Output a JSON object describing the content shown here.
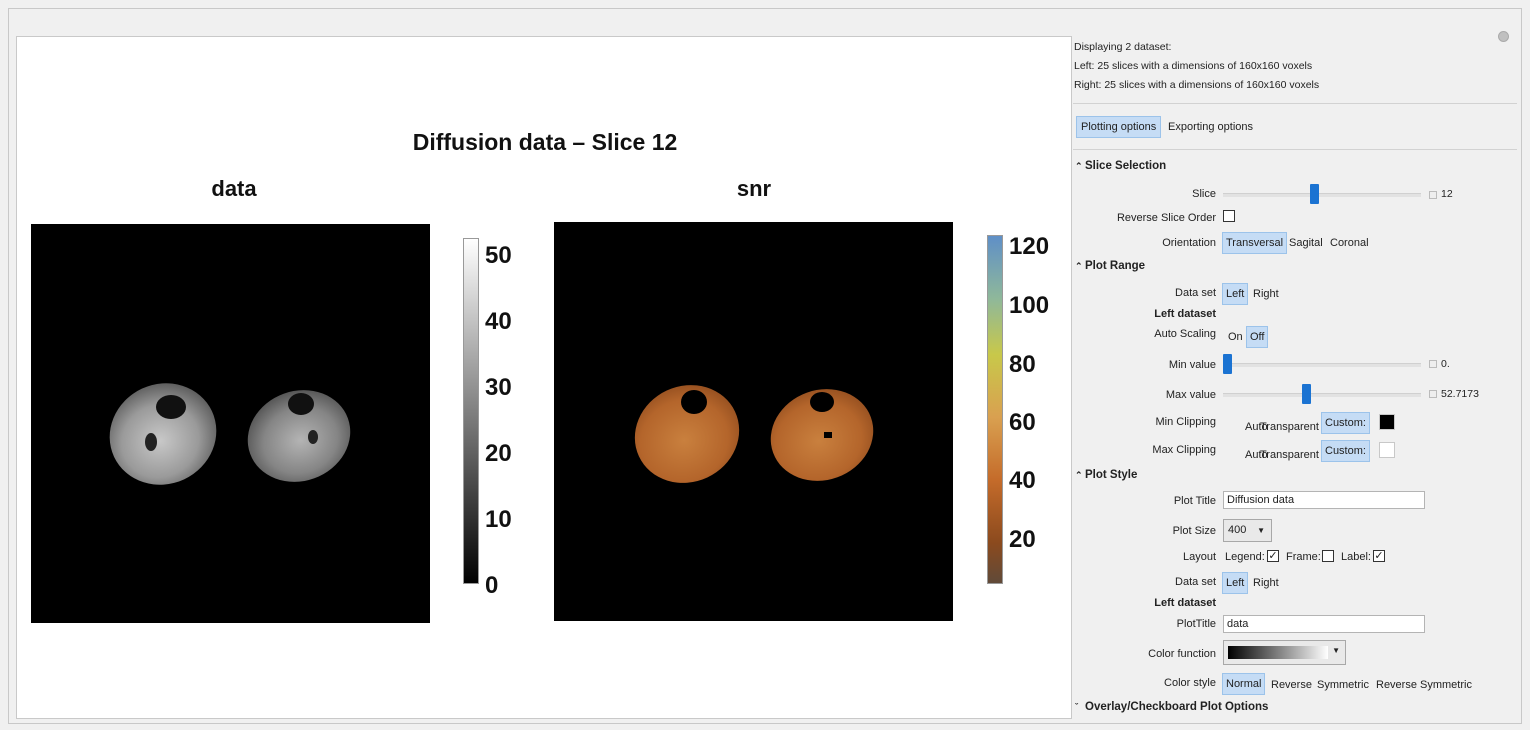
{
  "plot": {
    "title": "Diffusion data – Slice 12",
    "left_title": "data",
    "right_title": "snr",
    "left_colorbar_ticks": [
      "50",
      "40",
      "30",
      "20",
      "10",
      "0"
    ],
    "right_colorbar_ticks": [
      "120",
      "100",
      "80",
      "60",
      "40",
      "20"
    ]
  },
  "info": {
    "line1": "Displaying 2 dataset:",
    "line2": "Left: 25 slices with a dimensions of 160x160 voxels",
    "line3": "Right: 25 slices with a dimensions of 160x160 voxels"
  },
  "tabs": {
    "plotting": "Plotting options",
    "exporting": "Exporting options"
  },
  "slice_selection": {
    "header": "Slice Selection",
    "slice_label": "Slice",
    "slice_value": "12",
    "slice_fraction": 0.46,
    "reverse_label": "Reverse Slice Order",
    "orientation_label": "Orientation",
    "orientations": [
      "Transversal",
      "Sagital",
      "Coronal"
    ]
  },
  "plot_range": {
    "header": "Plot Range",
    "dataset_label": "Data set",
    "dataset_left": "Left",
    "dataset_right": "Right",
    "left_dataset_label": "Left dataset",
    "auto_scaling_label": "Auto Scaling",
    "auto_on": "On",
    "auto_off": "Off",
    "min_label": "Min value",
    "min_value": "0.",
    "min_fraction": 0.0,
    "max_label": "Max value",
    "max_value": "52.7173",
    "max_fraction": 0.42,
    "min_clip_label": "Min Clipping",
    "max_clip_label": "Max Clipping",
    "clip_auto": "Auto",
    "clip_transparent": "Transparent",
    "clip_custom": "Custom:",
    "min_clip_color": "#000000",
    "max_clip_color": "#ffffff"
  },
  "plot_style": {
    "header": "Plot Style",
    "plot_title_label": "Plot Title",
    "plot_title_value": "Diffusion data",
    "plot_size_label": "Plot Size",
    "plot_size_value": "400",
    "layout_label": "Layout",
    "legend_label": "Legend:",
    "frame_label": "Frame:",
    "label_label": "Label:",
    "dataset_label": "Data set",
    "dataset_left": "Left",
    "dataset_right": "Right",
    "left_dataset_label": "Left dataset",
    "plottitle_label": "PlotTitle",
    "plottitle_value": "data",
    "color_function_label": "Color function",
    "color_style_label": "Color style",
    "color_styles": [
      "Normal",
      "Reverse",
      "Symmetric",
      "Reverse Symmetric"
    ]
  },
  "overlay": {
    "header": "Overlay/Checkboard Plot Options"
  },
  "icons": {
    "settings": "gear-icon",
    "section_toggle": "chevron-up-icon",
    "collapsed_toggle": "chevron-down-icon",
    "dropdown": "triangle-down-icon",
    "check": "checkmark-icon"
  }
}
